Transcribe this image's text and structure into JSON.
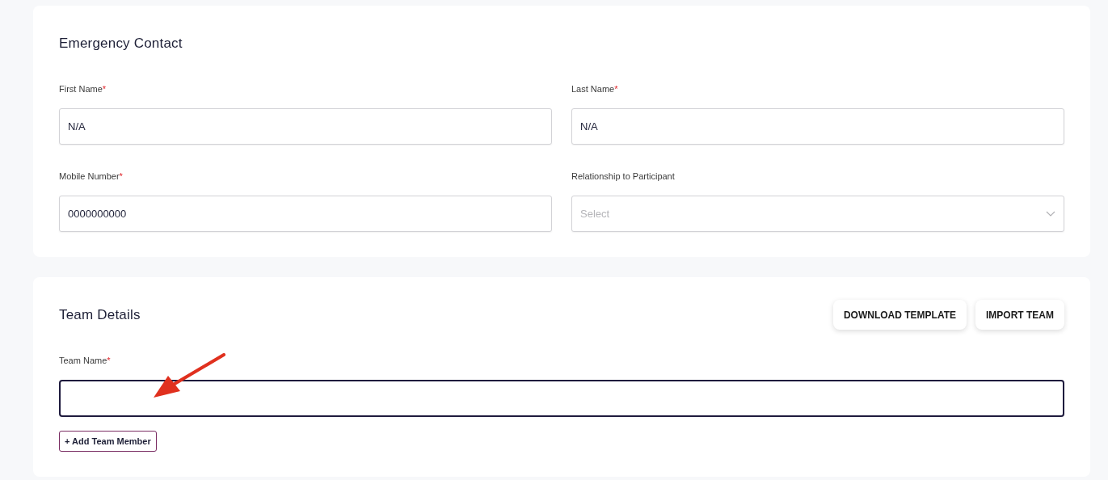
{
  "sections": [
    {
      "title": "Emergency Contact",
      "fields": [
        {
          "label": "First Name",
          "marker": "*",
          "kind": "text",
          "value": "N/A",
          "focused": false
        },
        {
          "label": "Last Name",
          "marker": "*",
          "kind": "text",
          "value": "N/A",
          "focused": false
        },
        {
          "label": "Mobile Number",
          "marker": "*",
          "kind": "text",
          "value": "0000000000",
          "focused": false
        },
        {
          "label": "Relationship to Participant",
          "kind": "select",
          "placeholder": "Select",
          "focused": false
        }
      ]
    },
    {
      "title": "Team Details",
      "actions": [
        "DOWNLOAD TEMPLATE",
        "IMPORT TEAM"
      ],
      "fields": [
        {
          "label": "Team Name",
          "marker": "*",
          "kind": "text",
          "focused": true
        }
      ],
      "add_button": "+ Add Team Member"
    }
  ]
}
